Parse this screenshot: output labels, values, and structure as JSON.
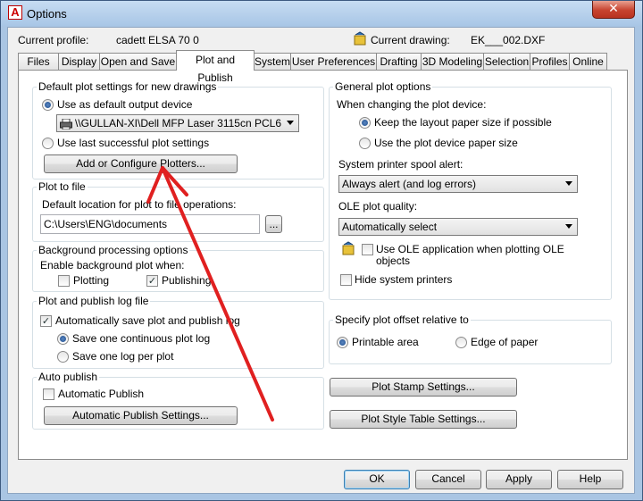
{
  "window": {
    "title": "Options",
    "close_glyph": "✕",
    "app_icon_glyph": "A"
  },
  "header": {
    "current_profile_label": "Current profile:",
    "current_profile_value": "cadett ELSA 70 0",
    "current_drawing_label": "Current drawing:",
    "current_drawing_value": "EK___002.DXF"
  },
  "tabs": [
    {
      "label": "Files"
    },
    {
      "label": "Display"
    },
    {
      "label": "Open and Save"
    },
    {
      "label": "Plot and Publish",
      "active": true
    },
    {
      "label": "System"
    },
    {
      "label": "User Preferences"
    },
    {
      "label": "Drafting"
    },
    {
      "label": "3D Modeling"
    },
    {
      "label": "Selection"
    },
    {
      "label": "Profiles"
    },
    {
      "label": "Online"
    }
  ],
  "default_plot": {
    "title": "Default plot settings for new drawings",
    "use_default_label": "Use as default output device",
    "device_value": "\\\\GULLAN-XI\\Dell MFP Laser 3115cn PCL6",
    "use_last_label": "Use last successful plot settings",
    "add_plotters_button": "Add or Configure Plotters..."
  },
  "plot_to_file": {
    "title": "Plot to file",
    "default_location_label": "Default location for plot to file operations:",
    "path_value": "C:\\Users\\ENG\\documents",
    "browse_button": "..."
  },
  "background": {
    "title": "Background processing options",
    "enable_label": "Enable background plot when:",
    "plotting_label": "Plotting",
    "plotting_checked": false,
    "publishing_label": "Publishing",
    "publishing_checked": true
  },
  "log": {
    "title": "Plot and publish log file",
    "auto_save_label": "Automatically save plot and publish log",
    "auto_save_checked": true,
    "continuous_label": "Save one continuous plot log",
    "per_plot_label": "Save one log per plot"
  },
  "auto_publish": {
    "title": "Auto publish",
    "automatic_publish_label": "Automatic Publish",
    "automatic_publish_checked": false,
    "settings_button": "Automatic Publish Settings..."
  },
  "general": {
    "title": "General plot options",
    "when_changing_label": "When changing the plot device:",
    "keep_layout_label": "Keep the layout paper size if possible",
    "use_device_label": "Use the plot device paper size",
    "spool_alert_label": "System printer spool alert:",
    "spool_alert_value": "Always alert (and log errors)",
    "ole_quality_label": "OLE plot quality:",
    "ole_quality_value": "Automatically select",
    "use_ole_label_line1": "Use OLE application when plotting OLE",
    "use_ole_label_line2": "objects",
    "use_ole_checked": false,
    "hide_printers_label": "Hide system printers",
    "hide_printers_checked": false
  },
  "offset": {
    "title": "Specify plot offset relative to",
    "printable_label": "Printable area",
    "edge_label": "Edge of paper"
  },
  "buttons": {
    "plot_stamp": "Plot Stamp Settings...",
    "plot_style": "Plot Style Table Settings...",
    "ok": "OK",
    "cancel": "Cancel",
    "apply": "Apply",
    "help": "Help"
  },
  "colors": {
    "annotation_arrow": "#e02020",
    "title_bar": "#a9c5e3",
    "ok_border": "#3c7fb1"
  }
}
